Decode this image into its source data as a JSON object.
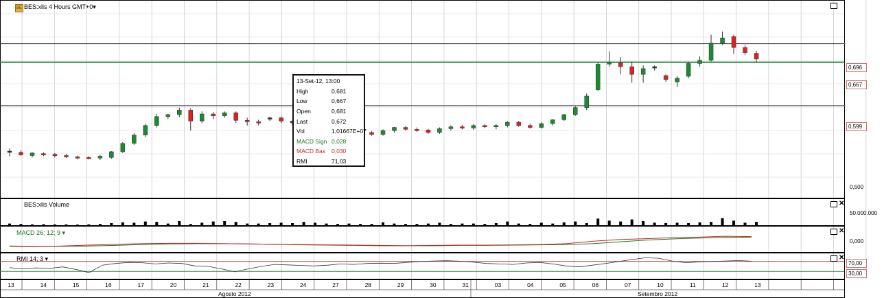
{
  "main_pane": {
    "title": "BES:xlis 4 Hours GMT+0",
    "title_arrow": "▾",
    "logo_text": "BE",
    "price_tags": [
      {
        "text": "0,696",
        "value": 0.696,
        "line_color": "#333333"
      },
      {
        "text": "0,667",
        "value": 0.667,
        "line_color": "#2a8a4a"
      },
      {
        "text": "0,599",
        "value": 0.599,
        "line_color": "#333333"
      }
    ],
    "axis_label": "0,500"
  },
  "tooltip": {
    "date": "13-Set-12, 13:00",
    "rows": [
      {
        "label": "High",
        "value": "0,681",
        "color": "#000000"
      },
      {
        "label": "Low",
        "value": "0,667",
        "color": "#000000"
      },
      {
        "label": "Open",
        "value": "0,681",
        "color": "#000000"
      },
      {
        "label": "Last",
        "value": "0,672",
        "color": "#000000"
      },
      {
        "label": "Vol",
        "value": "1,01667E+07",
        "color": "#000000"
      },
      {
        "label": "MACD Sign",
        "value": "0,028",
        "color": "#1a7a1a"
      },
      {
        "label": "MACD Bas",
        "value": "0,030",
        "color": "#cc2222"
      },
      {
        "label": "RMI",
        "value": "71,03",
        "color": "#000000"
      }
    ]
  },
  "volume_pane": {
    "title": "BES:xlis Volume",
    "axis_label": "50.000.000"
  },
  "macd_pane": {
    "title": "MACD 26; 12; 9",
    "title_arrow": "▾",
    "axis_label": "0,000"
  },
  "rmi_pane": {
    "title": "RMI 14; 3",
    "title_arrow": "▾",
    "axis_label_high": "70,00",
    "axis_label_low": "30,00"
  },
  "x_axis": {
    "days": [
      "13",
      "14",
      "15",
      "16",
      "17",
      "20",
      "21",
      "22",
      "23",
      "24",
      "27",
      "28",
      "29",
      "30",
      "31",
      "03",
      "04",
      "05",
      "06",
      "07",
      "10",
      "11",
      "12",
      "13",
      "",
      "",
      ""
    ],
    "months": [
      {
        "label": "Agosto 2012"
      },
      {
        "label": "Setembro 2012"
      }
    ]
  },
  "chart_data": {
    "type": "candlestick",
    "y_axis_price": {
      "min": 0.47,
      "max": 0.76
    },
    "candles": [
      {
        "o": 0.528,
        "h": 0.532,
        "l": 0.52,
        "c": 0.528,
        "color": "neutral"
      },
      {
        "o": 0.526,
        "h": 0.529,
        "l": 0.52,
        "c": 0.522,
        "color": "red"
      },
      {
        "o": 0.521,
        "h": 0.526,
        "l": 0.518,
        "c": 0.525,
        "color": "green"
      },
      {
        "o": 0.524,
        "h": 0.526,
        "l": 0.52,
        "c": 0.523,
        "color": "red"
      },
      {
        "o": 0.523,
        "h": 0.525,
        "l": 0.518,
        "c": 0.521,
        "color": "red"
      },
      {
        "o": 0.521,
        "h": 0.524,
        "l": 0.517,
        "c": 0.519,
        "color": "red"
      },
      {
        "o": 0.519,
        "h": 0.521,
        "l": 0.515,
        "c": 0.518,
        "color": "red"
      },
      {
        "o": 0.518,
        "h": 0.52,
        "l": 0.515,
        "c": 0.517,
        "color": "red"
      },
      {
        "o": 0.517,
        "h": 0.522,
        "l": 0.514,
        "c": 0.52,
        "color": "green"
      },
      {
        "o": 0.518,
        "h": 0.528,
        "l": 0.516,
        "c": 0.527,
        "color": "green"
      },
      {
        "o": 0.527,
        "h": 0.542,
        "l": 0.525,
        "c": 0.54,
        "color": "green"
      },
      {
        "o": 0.54,
        "h": 0.556,
        "l": 0.538,
        "c": 0.553,
        "color": "green"
      },
      {
        "o": 0.553,
        "h": 0.571,
        "l": 0.55,
        "c": 0.568,
        "color": "green"
      },
      {
        "o": 0.568,
        "h": 0.586,
        "l": 0.565,
        "c": 0.582,
        "color": "green"
      },
      {
        "o": 0.582,
        "h": 0.586,
        "l": 0.578,
        "c": 0.585,
        "color": "green"
      },
      {
        "o": 0.585,
        "h": 0.596,
        "l": 0.581,
        "c": 0.592,
        "color": "green"
      },
      {
        "o": 0.592,
        "h": 0.595,
        "l": 0.56,
        "c": 0.575,
        "color": "red"
      },
      {
        "o": 0.575,
        "h": 0.59,
        "l": 0.572,
        "c": 0.586,
        "color": "green"
      },
      {
        "o": 0.586,
        "h": 0.589,
        "l": 0.578,
        "c": 0.583,
        "color": "red"
      },
      {
        "o": 0.583,
        "h": 0.59,
        "l": 0.58,
        "c": 0.588,
        "color": "green"
      },
      {
        "o": 0.588,
        "h": 0.59,
        "l": 0.572,
        "c": 0.576,
        "color": "red"
      },
      {
        "o": 0.576,
        "h": 0.58,
        "l": 0.568,
        "c": 0.574,
        "color": "red"
      },
      {
        "o": 0.574,
        "h": 0.577,
        "l": 0.568,
        "c": 0.572,
        "color": "red"
      },
      {
        "o": 0.578,
        "h": 0.582,
        "l": 0.575,
        "c": 0.58,
        "color": "neutral"
      },
      {
        "o": 0.58,
        "h": 0.582,
        "l": 0.572,
        "c": 0.575,
        "color": "red"
      },
      {
        "o": 0.575,
        "h": 0.577,
        "l": 0.568,
        "c": 0.572,
        "color": "red"
      },
      {
        "o": 0.572,
        "h": 0.575,
        "l": 0.564,
        "c": 0.566,
        "color": "red"
      },
      {
        "o": 0.566,
        "h": 0.568,
        "l": 0.558,
        "c": 0.56,
        "color": "red"
      },
      {
        "o": 0.56,
        "h": 0.563,
        "l": 0.555,
        "c": 0.558,
        "color": "red"
      },
      {
        "o": 0.558,
        "h": 0.562,
        "l": 0.553,
        "c": 0.56,
        "color": "green"
      },
      {
        "o": 0.56,
        "h": 0.563,
        "l": 0.553,
        "c": 0.556,
        "color": "red"
      },
      {
        "o": 0.562,
        "h": 0.564,
        "l": 0.556,
        "c": 0.557,
        "color": "red"
      },
      {
        "o": 0.557,
        "h": 0.559,
        "l": 0.552,
        "c": 0.554,
        "color": "red"
      },
      {
        "o": 0.554,
        "h": 0.562,
        "l": 0.552,
        "c": 0.56,
        "color": "green"
      },
      {
        "o": 0.56,
        "h": 0.566,
        "l": 0.557,
        "c": 0.565,
        "color": "green"
      },
      {
        "o": 0.565,
        "h": 0.567,
        "l": 0.56,
        "c": 0.562,
        "color": "red"
      },
      {
        "o": 0.562,
        "h": 0.565,
        "l": 0.558,
        "c": 0.561,
        "color": "red"
      },
      {
        "o": 0.561,
        "h": 0.563,
        "l": 0.555,
        "c": 0.557,
        "color": "red"
      },
      {
        "o": 0.557,
        "h": 0.565,
        "l": 0.555,
        "c": 0.563,
        "color": "green"
      },
      {
        "o": 0.563,
        "h": 0.568,
        "l": 0.56,
        "c": 0.566,
        "color": "green"
      },
      {
        "o": 0.566,
        "h": 0.569,
        "l": 0.562,
        "c": 0.564,
        "color": "red"
      },
      {
        "o": 0.564,
        "h": 0.57,
        "l": 0.561,
        "c": 0.568,
        "color": "green"
      },
      {
        "o": 0.568,
        "h": 0.57,
        "l": 0.564,
        "c": 0.566,
        "color": "red"
      },
      {
        "o": 0.566,
        "h": 0.57,
        "l": 0.562,
        "c": 0.568,
        "color": "green"
      },
      {
        "o": 0.568,
        "h": 0.575,
        "l": 0.565,
        "c": 0.573,
        "color": "green"
      },
      {
        "o": 0.573,
        "h": 0.575,
        "l": 0.566,
        "c": 0.568,
        "color": "red"
      },
      {
        "o": 0.568,
        "h": 0.571,
        "l": 0.563,
        "c": 0.565,
        "color": "red"
      },
      {
        "o": 0.565,
        "h": 0.573,
        "l": 0.563,
        "c": 0.571,
        "color": "green"
      },
      {
        "o": 0.571,
        "h": 0.578,
        "l": 0.568,
        "c": 0.577,
        "color": "green"
      },
      {
        "o": 0.577,
        "h": 0.586,
        "l": 0.575,
        "c": 0.585,
        "color": "green"
      },
      {
        "o": 0.585,
        "h": 0.598,
        "l": 0.583,
        "c": 0.596,
        "color": "green"
      },
      {
        "o": 0.596,
        "h": 0.618,
        "l": 0.592,
        "c": 0.614,
        "color": "green"
      },
      {
        "o": 0.624,
        "h": 0.667,
        "l": 0.622,
        "c": 0.664,
        "color": "green"
      },
      {
        "o": 0.664,
        "h": 0.684,
        "l": 0.66,
        "c": 0.667,
        "color": "green"
      },
      {
        "o": 0.666,
        "h": 0.675,
        "l": 0.648,
        "c": 0.66,
        "color": "red"
      },
      {
        "o": 0.66,
        "h": 0.668,
        "l": 0.635,
        "c": 0.648,
        "color": "red"
      },
      {
        "o": 0.648,
        "h": 0.662,
        "l": 0.635,
        "c": 0.657,
        "color": "green"
      },
      {
        "o": 0.66,
        "h": 0.662,
        "l": 0.654,
        "c": 0.658,
        "color": "neutral"
      },
      {
        "o": 0.646,
        "h": 0.648,
        "l": 0.636,
        "c": 0.64,
        "color": "red"
      },
      {
        "o": 0.636,
        "h": 0.645,
        "l": 0.628,
        "c": 0.642,
        "color": "green"
      },
      {
        "o": 0.645,
        "h": 0.668,
        "l": 0.642,
        "c": 0.665,
        "color": "green"
      },
      {
        "o": 0.665,
        "h": 0.676,
        "l": 0.66,
        "c": 0.67,
        "color": "green"
      },
      {
        "o": 0.67,
        "h": 0.71,
        "l": 0.668,
        "c": 0.697,
        "color": "green"
      },
      {
        "o": 0.697,
        "h": 0.715,
        "l": 0.694,
        "c": 0.705,
        "color": "green"
      },
      {
        "o": 0.707,
        "h": 0.71,
        "l": 0.68,
        "c": 0.69,
        "color": "red"
      },
      {
        "o": 0.69,
        "h": 0.694,
        "l": 0.678,
        "c": 0.682,
        "color": "red"
      },
      {
        "o": 0.681,
        "h": 0.685,
        "l": 0.667,
        "c": 0.672,
        "color": "red"
      }
    ],
    "volume": [
      0.2,
      0.15,
      0.1,
      0.12,
      0.1,
      0.1,
      0.08,
      0.1,
      0.15,
      0.25,
      0.35,
      0.3,
      0.45,
      0.4,
      0.2,
      0.5,
      0.15,
      0.3,
      0.45,
      0.5,
      0.4,
      0.2,
      0.2,
      0.25,
      0.3,
      0.25,
      0.4,
      0.3,
      0.2,
      0.15,
      0.2,
      0.15,
      0.15,
      0.35,
      0.2,
      0.15,
      0.15,
      0.2,
      0.3,
      0.15,
      0.2,
      0.2,
      0.15,
      0.25,
      0.45,
      0.2,
      0.15,
      0.3,
      0.2,
      0.35,
      0.45,
      0.25,
      0.8,
      0.55,
      0.45,
      0.7,
      0.5,
      0.3,
      0.25,
      0.3,
      0.25,
      0.35,
      0.4,
      0.85,
      0.55,
      0.3,
      0.4
    ],
    "macd": {
      "min": -0.02,
      "max": 0.05,
      "signal": [
        -0.002,
        -0.003,
        -0.003,
        -0.002,
        0,
        0.003,
        0.005,
        0.006,
        0.006,
        0.005,
        0.004,
        0.003,
        0.002,
        0.001,
        0,
        -0.001,
        -0.001,
        0,
        0,
        0.001,
        0.002,
        0.003,
        0.006,
        0.012,
        0.018,
        0.022,
        0.025,
        0.027,
        0.028
      ],
      "base": [
        -0.003,
        -0.004,
        -0.002,
        0.001,
        0.004,
        0.006,
        0.007,
        0.007,
        0.006,
        0.005,
        0.004,
        0.002,
        0.001,
        0,
        -0.001,
        -0.001,
        0,
        0.001,
        0.001,
        0.002,
        0.003,
        0.006,
        0.014,
        0.02,
        0.023,
        0.026,
        0.028,
        0.031,
        0.03
      ]
    },
    "rmi": {
      "min": 0,
      "max": 100,
      "values": [
        45,
        40,
        44,
        42,
        48,
        38,
        25,
        55,
        62,
        66,
        65,
        60,
        64,
        62,
        52,
        50,
        40,
        28,
        40,
        50,
        58,
        56,
        54,
        52,
        55,
        60,
        58,
        62,
        63,
        62,
        66,
        70,
        72,
        73,
        71,
        67,
        62,
        60,
        58,
        64,
        66,
        60,
        52,
        48,
        55,
        62,
        70,
        78,
        85,
        83,
        72,
        65,
        68,
        70,
        72,
        74,
        71
      ]
    }
  }
}
